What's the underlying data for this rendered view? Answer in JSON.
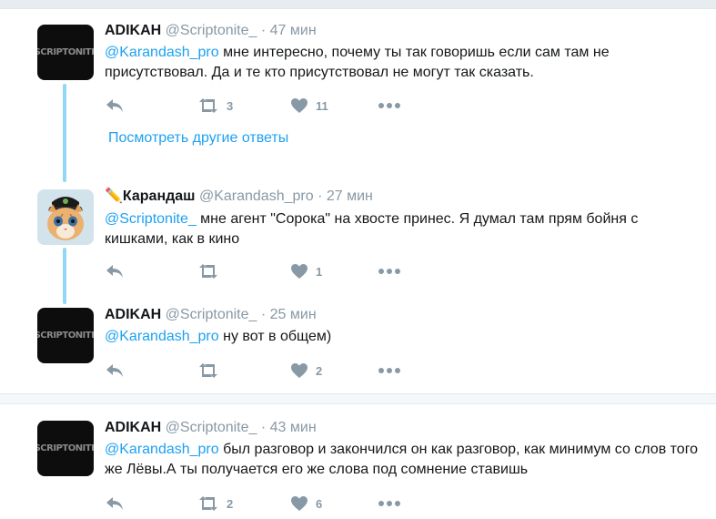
{
  "tweets": [
    {
      "name": "ADIKAH",
      "handle": "@Scriptonite_",
      "time": "· 47 мин",
      "mention": "@Karandash_pro",
      "text": " мне интересно, почему ты так говоришь если сам там не присутствовал. Да и те кто присутствовал не могут так сказать.",
      "retweets": "3",
      "likes": "11",
      "avatar": "SCRIPTONITE"
    },
    {
      "name": "✏️Карандаш",
      "handle": "@Karandash_pro",
      "time": "· 27 мин",
      "mention": "@Scriptonite_",
      "text": " мне агент \"Сорока\" на хвосте принес. Я думал там прям бойня с кишками, как в кино",
      "retweets": "",
      "likes": "1"
    },
    {
      "name": "ADIKAH",
      "handle": "@Scriptonite_",
      "time": "· 25 мин",
      "mention": "@Karandash_pro",
      "text": " ну вот в общем)",
      "retweets": "",
      "likes": "2",
      "avatar": "SCRIPTONITE"
    },
    {
      "name": "ADIKAH",
      "handle": "@Scriptonite_",
      "time": "· 43 мин",
      "mention": "@Karandash_pro",
      "text": " был разговор и закончился он как разговор, как минимум со слов того же Лёвы.А ты получается его же слова под сомнение ставишь",
      "retweets": "2",
      "likes": "6",
      "avatar": "SCRIPTONITE"
    }
  ],
  "more_replies": "Посмотреть другие ответы",
  "colors": {
    "accent": "#1da1f2",
    "thread_line": "#90d8f5",
    "muted": "#8899a6"
  },
  "icons": [
    "reply-icon",
    "retweet-icon",
    "heart-icon",
    "more-icon"
  ]
}
